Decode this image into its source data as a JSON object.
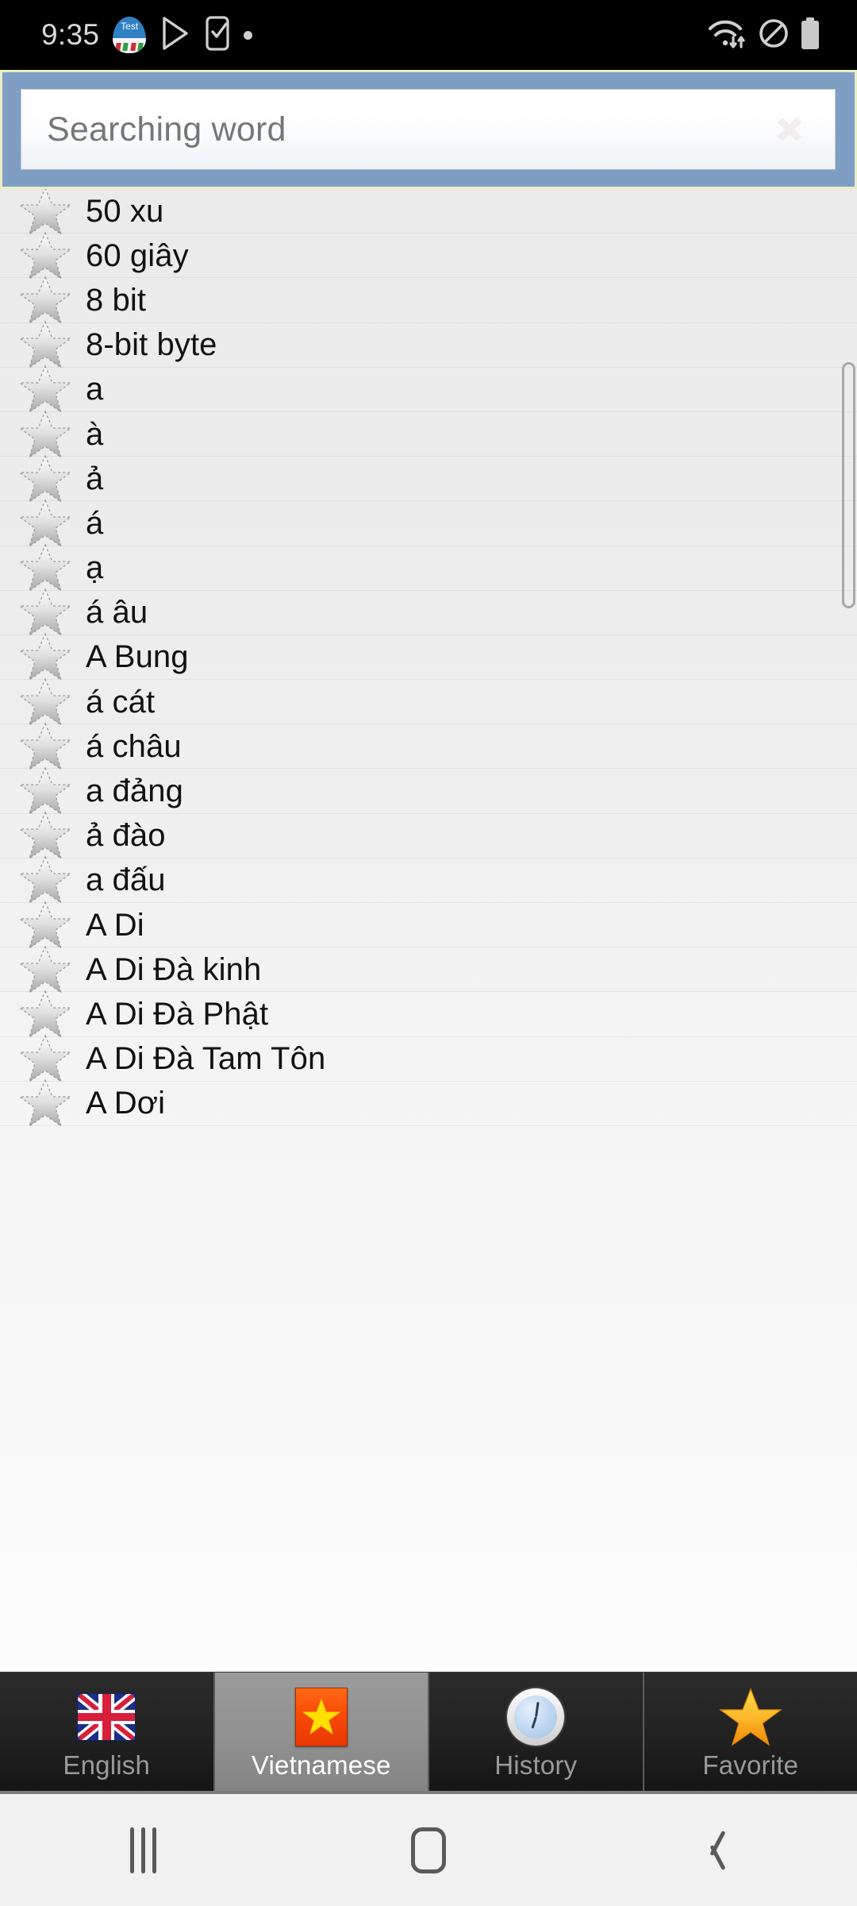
{
  "status_bar": {
    "time": "9:35",
    "app_badge_text": "Test",
    "icons_left": [
      "app-egg-icon",
      "play-store-icon",
      "phone-check-icon",
      "dot-icon"
    ],
    "icons_right": [
      "wifi-transfer-icon",
      "do-not-disturb-icon",
      "battery-icon"
    ],
    "background_color": "#000000"
  },
  "search": {
    "placeholder": "Searching word",
    "value": "",
    "clear_icon": "clear-octagon-icon",
    "bar_color": "#7e9ec4",
    "border_color": "#e8edc4"
  },
  "list": {
    "items": [
      {
        "label": "50 xu",
        "favorite_icon": "star-outline-icon"
      },
      {
        "label": "60 giây",
        "favorite_icon": "star-outline-icon"
      },
      {
        "label": "8 bit",
        "favorite_icon": "star-outline-icon"
      },
      {
        "label": "8-bit byte",
        "favorite_icon": "star-outline-icon"
      },
      {
        "label": "a",
        "favorite_icon": "star-outline-icon"
      },
      {
        "label": "à",
        "favorite_icon": "star-outline-icon"
      },
      {
        "label": "ả",
        "favorite_icon": "star-outline-icon"
      },
      {
        "label": "á",
        "favorite_icon": "star-outline-icon"
      },
      {
        "label": "ạ",
        "favorite_icon": "star-outline-icon"
      },
      {
        "label": "á âu",
        "favorite_icon": "star-outline-icon"
      },
      {
        "label": "A Bung",
        "favorite_icon": "star-outline-icon"
      },
      {
        "label": "á cát",
        "favorite_icon": "star-outline-icon"
      },
      {
        "label": "á châu",
        "favorite_icon": "star-outline-icon"
      },
      {
        "label": "a đảng",
        "favorite_icon": "star-outline-icon"
      },
      {
        "label": "ả đào",
        "favorite_icon": "star-outline-icon"
      },
      {
        "label": "a đấu",
        "favorite_icon": "star-outline-icon"
      },
      {
        "label": "A Di",
        "favorite_icon": "star-outline-icon"
      },
      {
        "label": "A Di Đà kinh",
        "favorite_icon": "star-outline-icon"
      },
      {
        "label": "A Di Đà Phật",
        "favorite_icon": "star-outline-icon"
      },
      {
        "label": "A Di Đà Tam Tôn",
        "favorite_icon": "star-outline-icon"
      },
      {
        "label": "A Dơi",
        "favorite_icon": "star-outline-icon"
      }
    ]
  },
  "tabs": [
    {
      "label": "English",
      "icon": "uk-flag-icon",
      "selected": false
    },
    {
      "label": "Vietnamese",
      "icon": "vietnam-flag-icon",
      "selected": true
    },
    {
      "label": "History",
      "icon": "clock-icon",
      "selected": false
    },
    {
      "label": "Favorite",
      "icon": "gold-star-icon",
      "selected": false
    }
  ],
  "nav_bar": {
    "recents_label": "recents-icon",
    "home_label": "home-icon",
    "back_label": "back-icon"
  }
}
